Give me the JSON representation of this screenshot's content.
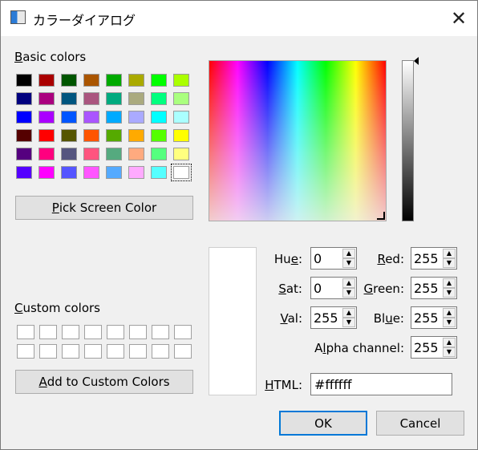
{
  "window": {
    "title": "カラーダイアログ",
    "close_glyph": "✕"
  },
  "basic": {
    "label_u": "B",
    "label_rest": "asic colors",
    "rows": [
      [
        "#000000",
        "#aa0000",
        "#005500",
        "#aa5500",
        "#00aa00",
        "#aaaa00",
        "#00ff00",
        "#aaff00"
      ],
      [
        "#00007f",
        "#aa007f",
        "#00557f",
        "#aa557f",
        "#00aa7f",
        "#aaaa7f",
        "#00ff7f",
        "#aaff7f"
      ],
      [
        "#0000ff",
        "#aa00ff",
        "#0055ff",
        "#aa55ff",
        "#00aaff",
        "#aaaaff",
        "#00ffff",
        "#aaffff"
      ],
      [
        "#550000",
        "#ff0000",
        "#555500",
        "#ff5500",
        "#55aa00",
        "#ffaa00",
        "#55ff00",
        "#ffff00"
      ],
      [
        "#55007f",
        "#ff007f",
        "#55557f",
        "#ff557f",
        "#55aa7f",
        "#ffaa7f",
        "#55ff7f",
        "#ffff7f"
      ],
      [
        "#5500ff",
        "#ff00ff",
        "#5555ff",
        "#ff55ff",
        "#55aaff",
        "#ffaaff",
        "#55ffff",
        "#ffffff"
      ]
    ]
  },
  "pick_screen": {
    "label_u": "P",
    "label_rest": "ick Screen Color"
  },
  "custom": {
    "label_u": "C",
    "label_rest": "ustom colors",
    "count": 16
  },
  "add_custom": {
    "label_u": "A",
    "label_rest": "dd to Custom Colors"
  },
  "fields": {
    "hue": {
      "label_pre": "Hu",
      "label_u": "e",
      "label_post": ":",
      "value": "0"
    },
    "sat": {
      "label_pre": "",
      "label_u": "S",
      "label_post": "at:",
      "value": "0"
    },
    "val": {
      "label_pre": "",
      "label_u": "V",
      "label_post": "al:",
      "value": "255"
    },
    "red": {
      "label_pre": "",
      "label_u": "R",
      "label_post": "ed:",
      "value": "255"
    },
    "green": {
      "label_pre": "",
      "label_u": "G",
      "label_post": "reen:",
      "value": "255"
    },
    "blue": {
      "label_pre": "Bl",
      "label_u": "u",
      "label_post": "e:",
      "value": "255"
    },
    "alpha": {
      "label_pre": "A",
      "label_u": "l",
      "label_post": "pha channel:",
      "value": "255"
    }
  },
  "html": {
    "label_u": "H",
    "label_rest": "TML:",
    "value": "#ffffff"
  },
  "buttons": {
    "ok": "OK",
    "cancel": "Cancel"
  },
  "colors": {
    "accent": "#0078d7",
    "current_color": "#ffffff"
  },
  "icons": {
    "app": "color-dialog-app-icon",
    "close": "close-icon",
    "spin_up": "spin-up-icon",
    "spin_down": "spin-down-icon"
  }
}
